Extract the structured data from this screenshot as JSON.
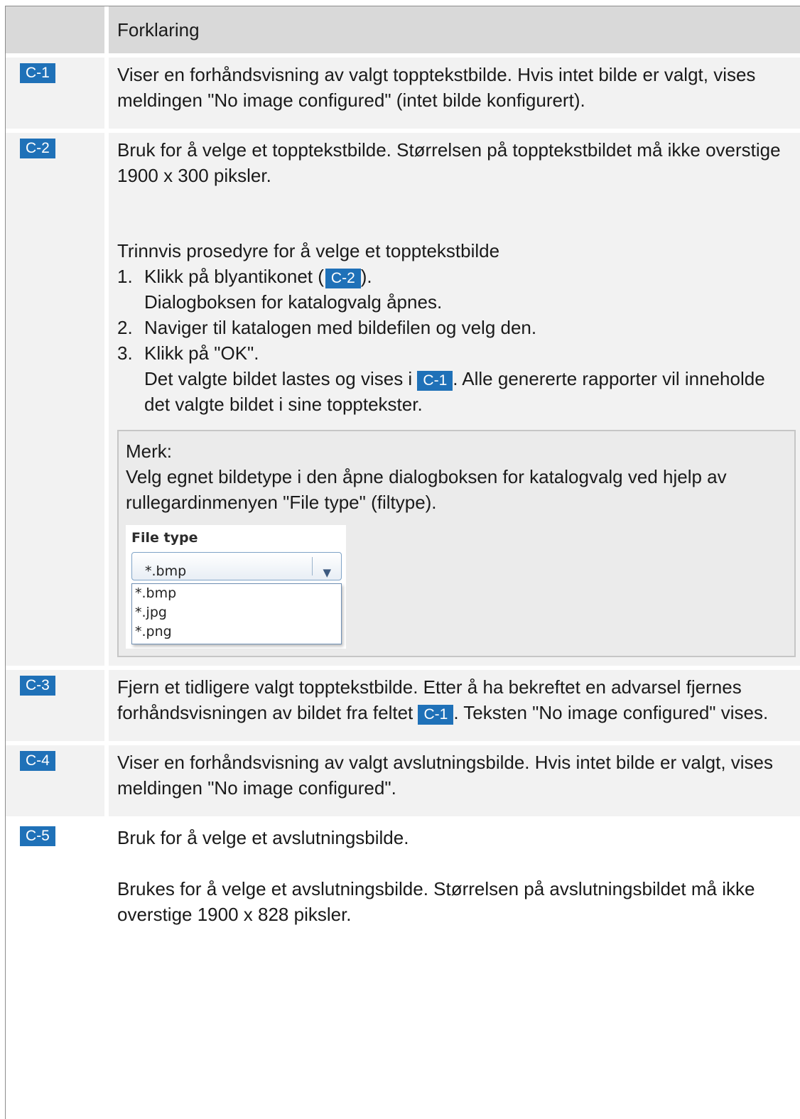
{
  "header": {
    "col1": "",
    "col2": "Forklaring"
  },
  "rows": [
    {
      "id": "C-1",
      "text": "Viser en forhåndsvisning av valgt topptekstbilde. Hvis intet bilde er valgt, vises meldingen \"No image configured\" (intet bilde konfigurert)."
    },
    {
      "id": "C-2",
      "intro": "Bruk for å velge et topptekstbilde. Størrelsen på topptekstbildet må ikke overstige 1900 x 300 piksler.",
      "procedure_title": "Trinnvis prosedyre for å velge et topptekstbilde",
      "steps": {
        "s1_num": "1.",
        "s1_text_a": "Klikk på  blyantikonet (",
        "s1_badge": "C-2",
        "s1_text_b": ").",
        "s1_sub": "Dialogboksen for katalogvalg åpnes.",
        "s2_num": "2.",
        "s2_text": "Naviger til katalogen med bildefilen og velg den.",
        "s3_num": "3.",
        "s3_text": "Klikk på \"OK\".",
        "s3_sub_a": "Det valgte bildet lastes og vises i ",
        "s3_badge": "C-1",
        "s3_sub_b": ". Alle genererte rapporter vil inneholde det valgte bildet i sine topptekster."
      },
      "note": {
        "label": "Merk:",
        "text": "Velg egnet bildetype i den åpne dialogboksen for katalogvalg ved hjelp av rullegardinmenyen \"File type\" (filtype).",
        "file_type": {
          "label": "File type",
          "selected": "*.bmp",
          "options": [
            "*.bmp",
            "*.jpg",
            "*.png"
          ]
        }
      }
    },
    {
      "id": "C-3",
      "text_a": "Fjern et tidligere valgt topptekstbilde. Etter å ha bekreftet en advarsel fjernes forhåndsvisningen av bildet fra feltet ",
      "badge": "C-1",
      "text_b": ". Teksten \"No image configured\" vises."
    },
    {
      "id": "C-4",
      "text": "Viser en forhåndsvisning av valgt avslutningsbilde. Hvis intet bilde er valgt, vises meldingen \"No image configured\"."
    },
    {
      "id": "C-5",
      "text": "Bruk for å velge et avslutningsbilde.",
      "text2": "Brukes for å velge et avslutningsbilde. Størrelsen på avslutningsbildet må ikke overstige 1900 x 828 piksler."
    }
  ],
  "colors": {
    "badge": "#1f71b8",
    "header_bg": "#d9d9d9",
    "row_bg": "#f2f2f2",
    "note_bg": "#ebebeb"
  }
}
